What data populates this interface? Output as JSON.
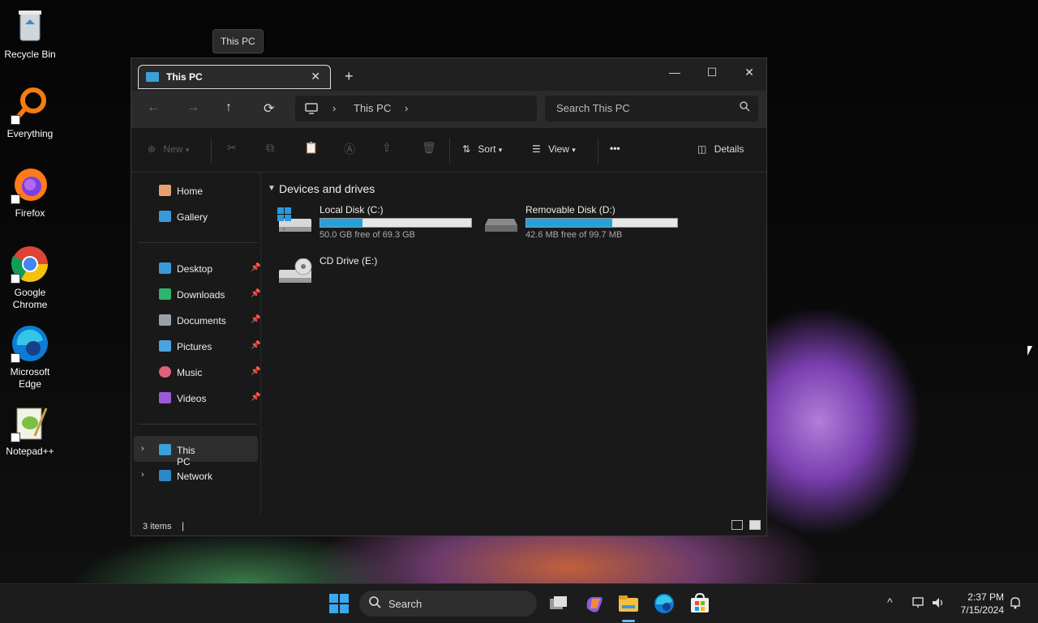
{
  "tooltip": "This PC",
  "desktop": {
    "icons": [
      {
        "label": "Recycle Bin"
      },
      {
        "label": "Everything"
      },
      {
        "label": "Firefox"
      },
      {
        "label": "Google Chrome"
      },
      {
        "label": "Microsoft Edge"
      },
      {
        "label": "Notepad++"
      }
    ]
  },
  "window": {
    "tab_title": "This PC",
    "tab_close": "✕",
    "new_tab": "+",
    "minimize": "—",
    "maximize": "☐",
    "close": "✕",
    "nav": {
      "back": "←",
      "forward": "→",
      "up": "↑",
      "refresh": "⟳"
    },
    "address": {
      "crumb": "This PC",
      "sep1": "›",
      "sep2": "›"
    },
    "search_placeholder": "Search This PC",
    "toolbar": {
      "new": "New",
      "sort": "Sort",
      "view": "View",
      "more": "•••",
      "details": "Details"
    },
    "sidebar": {
      "quick": [
        {
          "label": "Home",
          "color": "#e8a070"
        },
        {
          "label": "Gallery",
          "color": "#3a9ad8"
        }
      ],
      "pinned": [
        {
          "label": "Desktop",
          "color": "#3a9ad8"
        },
        {
          "label": "Downloads",
          "color": "#2fb36d"
        },
        {
          "label": "Documents",
          "color": "#9aa0a8"
        },
        {
          "label": "Pictures",
          "color": "#4aa3e0"
        },
        {
          "label": "Music",
          "color": "#e0607a"
        },
        {
          "label": "Videos",
          "color": "#9a5ad8"
        }
      ],
      "tree": [
        {
          "label": "This PC"
        },
        {
          "label": "Network"
        }
      ]
    },
    "content": {
      "group_title": "Devices and drives",
      "drives": [
        {
          "name": "Local Disk (C:)",
          "free": "50.0 GB free of 69.3 GB",
          "used_fraction": 0.28
        },
        {
          "name": "Removable Disk (D:)",
          "free": "42.6 MB free of 99.7 MB",
          "used_fraction": 0.57
        },
        {
          "name": "CD Drive (E:)"
        }
      ]
    },
    "status": {
      "count": "3 items",
      "caret": "|"
    }
  },
  "taskbar": {
    "search": "Search",
    "time": "2:37 PM",
    "date": "7/15/2024",
    "tray_up": "^"
  },
  "colors": {
    "accent": "#26a0da"
  }
}
